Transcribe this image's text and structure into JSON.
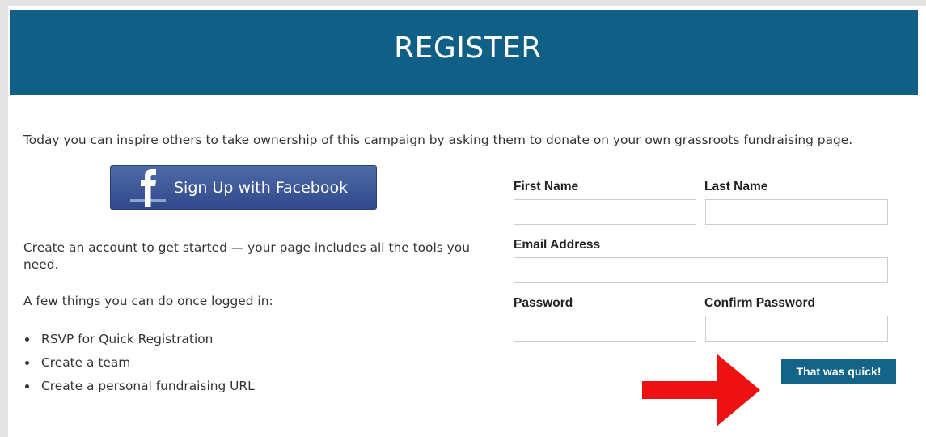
{
  "header": {
    "title": "REGISTER",
    "background_color": "#0f5f86"
  },
  "intro": {
    "text": "Today you can inspire others to take ownership of this campaign by asking them to donate on your own grassroots fundraising page."
  },
  "facebook": {
    "label": "Sign Up with Facebook",
    "icon": "facebook-f-icon",
    "color": "#3b5998"
  },
  "left": {
    "paragraph1": "Create an account to get started — your page includes all the tools you need.",
    "paragraph2": "A few things you can do once logged in:",
    "bullets": [
      "RSVP for Quick Registration",
      "Create a team",
      "Create a personal fundraising URL"
    ]
  },
  "form": {
    "first_name": {
      "label": "First Name",
      "value": ""
    },
    "last_name": {
      "label": "Last Name",
      "value": ""
    },
    "email": {
      "label": "Email Address",
      "value": ""
    },
    "password": {
      "label": "Password",
      "value": ""
    },
    "confirm_password": {
      "label": "Confirm Password",
      "value": ""
    },
    "submit_label": "That was quick!"
  },
  "annotation": {
    "arrow_color": "#ee1111",
    "arrow_icon": "right-arrow-icon"
  }
}
